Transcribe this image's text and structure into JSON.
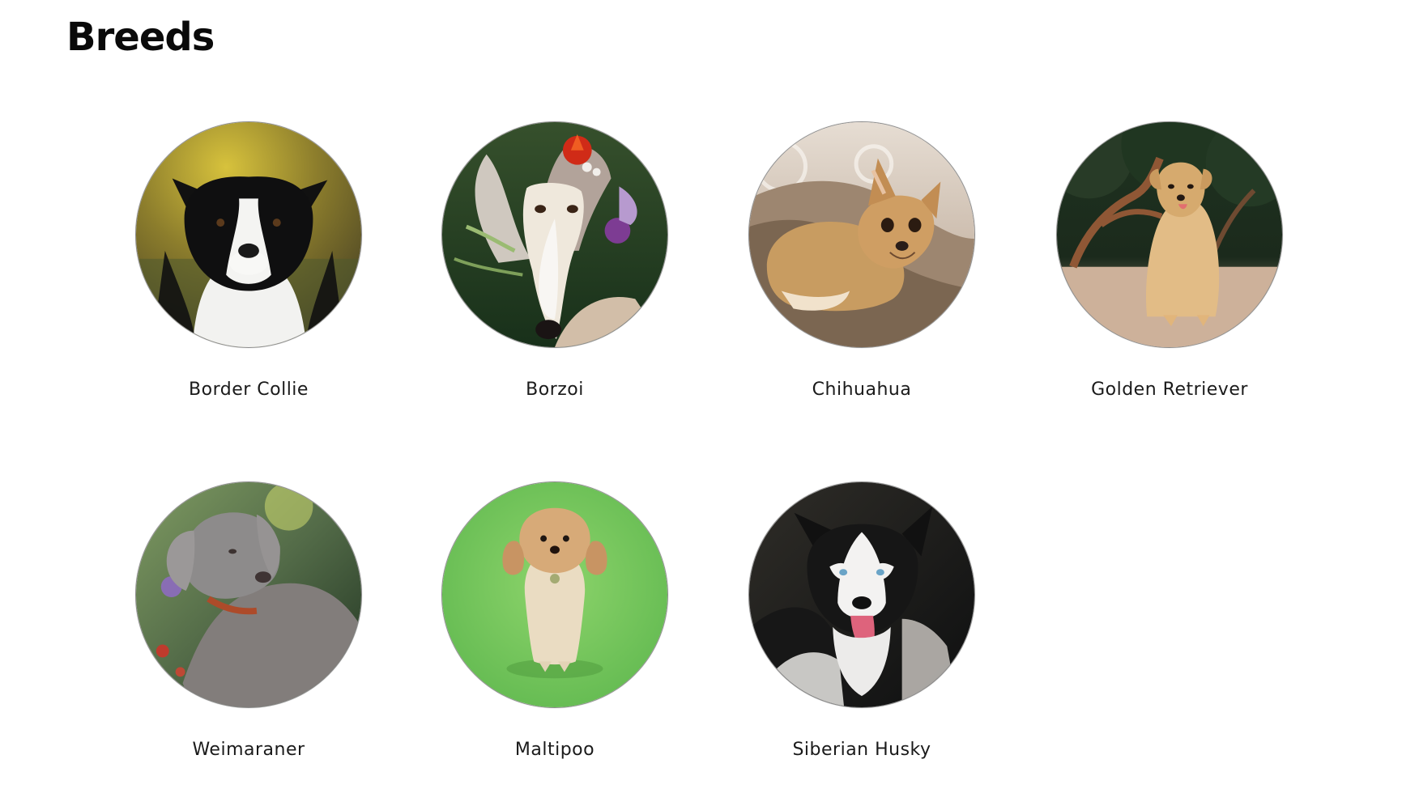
{
  "page": {
    "title": "Breeds"
  },
  "breeds": [
    {
      "name": "Border Collie",
      "image": "border-collie-photo"
    },
    {
      "name": "Borzoi",
      "image": "borzoi-photo"
    },
    {
      "name": "Chihuahua",
      "image": "chihuahua-photo"
    },
    {
      "name": "Golden Retriever",
      "image": "golden-retriever-photo"
    },
    {
      "name": "Weimaraner",
      "image": "weimaraner-photo"
    },
    {
      "name": "Maltipoo",
      "image": "maltipoo-photo"
    },
    {
      "name": "Siberian Husky",
      "image": "siberian-husky-photo"
    }
  ]
}
